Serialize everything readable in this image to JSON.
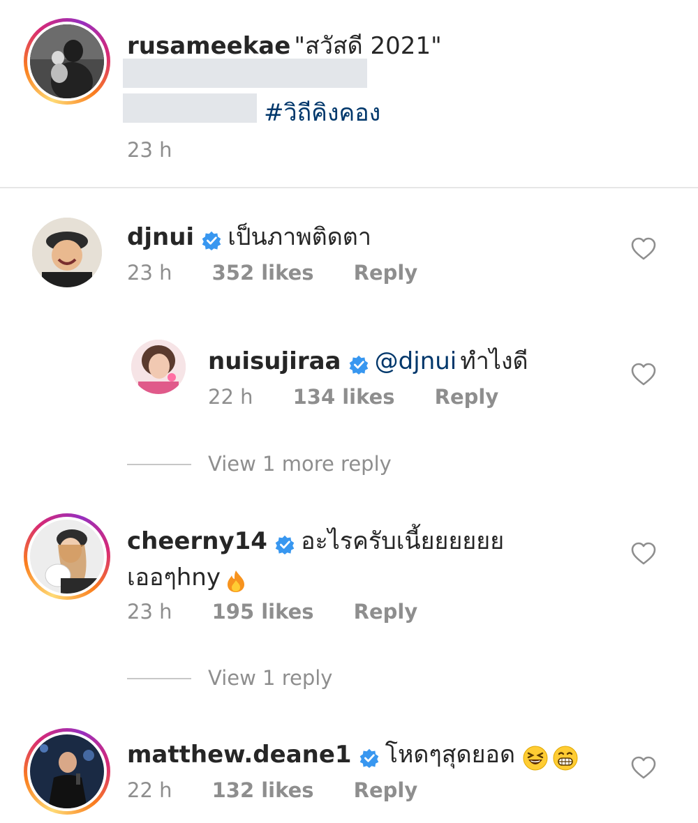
{
  "post": {
    "username": "rusameekae",
    "caption": "\"สวัสดี 2021\"",
    "hashtag": "#วิถีคิงคอง",
    "time": "23 h"
  },
  "comments": [
    {
      "username": "djnui",
      "text": "เป็นภาพติดตา",
      "time": "23 h",
      "likes": "352 likes",
      "reply": "Reply"
    },
    {
      "username": "nuisujiraa",
      "mention": "@djnui",
      "text": "ทำไงดี",
      "time": "22 h",
      "likes": "134 likes",
      "reply": "Reply"
    },
    {
      "view_replies": "View 1 more reply"
    },
    {
      "username": "cheerny14",
      "text": "อะไรครับเนี้ยยยยยย",
      "text2": "เออๆhny",
      "time": "23 h",
      "likes": "195 likes",
      "reply": "Reply"
    },
    {
      "view_replies": "View 1 reply"
    },
    {
      "username": "matthew.deane1",
      "text": "โหดๆสุดยอด",
      "time": "22 h",
      "likes": "132 likes",
      "reply": "Reply"
    }
  ],
  "colors": {
    "verified": "#3897f0",
    "mention": "#00376b",
    "meta": "#8e8e8e"
  },
  "icons": [
    "verified-icon",
    "heart-icon",
    "fire-emoji",
    "laughing-emoji",
    "grinning-emoji"
  ]
}
